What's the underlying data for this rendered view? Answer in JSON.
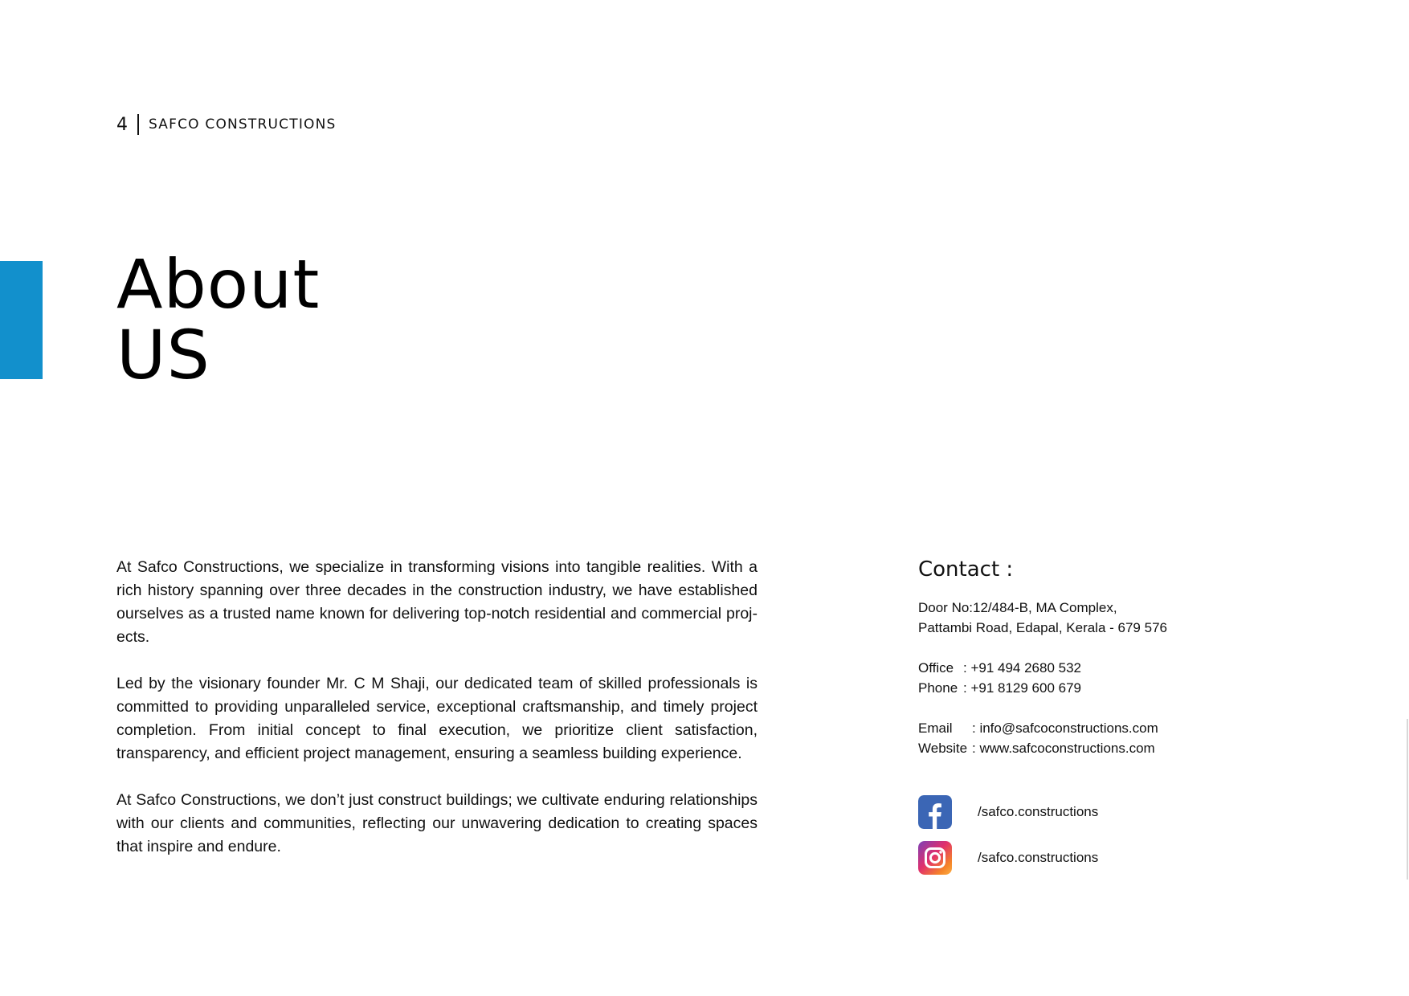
{
  "colors": {
    "accent": "#1290cc",
    "facebook": "#3b66b5",
    "instagram_gradient": [
      "#7b3fb8",
      "#e1306c",
      "#f58529",
      "#fcb045"
    ]
  },
  "header": {
    "page_number": "4",
    "company_name": "SAFCO CONSTRUCTIONS"
  },
  "title": {
    "line1": "About",
    "line2": "US"
  },
  "body": {
    "paragraphs": [
      "At Safco Constructions, we specialize in transforming visions into tangible realities. With a rich history spanning over three decades in the construction industry, we have established ourselves as a trusted name known for delivering top-notch residential and commercial proj­ects.",
      "Led by the visionary founder Mr. C M Shaji, our dedicated team of skilled professionals is com­mitted to providing unparalleled service, exceptional craftsmanship, and timely project com­pletion. From initial concept to final execution, we prioritize client satisfaction, transparency, and efficient project management, ensuring a seamless building experience.",
      "At Safco Constructions, we don’t just construct buildings; we cultivate enduring relationships with our clients and communities, reflecting our unwavering dedication to creating spaces that inspire and endure."
    ]
  },
  "contact": {
    "heading": "Contact :",
    "address_line1": "Door No:12/484-B, MA Complex,",
    "address_line2": "Pattambi Road, Edapal, Kerala - 679 576",
    "office_label": "Office",
    "office_value": ": +91 494 2680 532",
    "phone_label": "Phone",
    "phone_value": ": +91 8129 600 679",
    "email_label": "Email",
    "email_value": ": info@safcoconstructions.com",
    "website_label": "Website",
    "website_value": ": www.safcoconstructions.com",
    "social": [
      {
        "icon": "facebook-icon",
        "handle": "/safco.constructions"
      },
      {
        "icon": "instagram-icon",
        "handle": "/safco.constructions"
      }
    ]
  }
}
